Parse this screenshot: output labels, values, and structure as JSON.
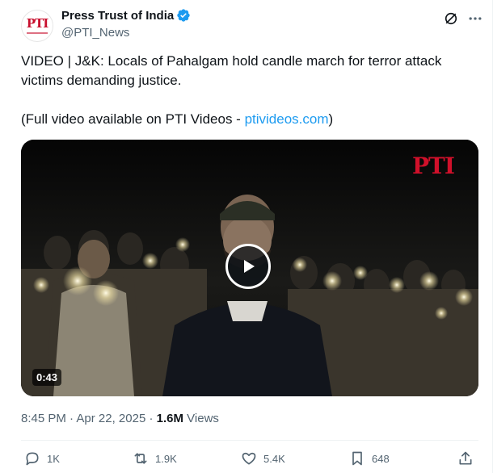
{
  "author": {
    "name": "Press Trust of India",
    "handle": "@PTI_News",
    "avatar_text": "PTI"
  },
  "post": {
    "line1": "VIDEO | J&K: Locals of Pahalgam hold candle march for terror attack victims demanding justice.",
    "line2_prefix": "(Full video available on PTI Videos - ",
    "line2_link": "ptivideos.com",
    "line2_suffix": ")"
  },
  "video": {
    "watermark": "PTI",
    "duration": "0:43"
  },
  "meta": {
    "time": "8:45 PM",
    "separator1": " · ",
    "date": "Apr 22, 2025",
    "separator2": " · ",
    "views_count": "1.6M",
    "views_label": " Views"
  },
  "actions": {
    "replies": "1K",
    "reposts": "1.9K",
    "likes": "5.4K",
    "bookmarks": "648"
  },
  "colors": {
    "accent": "#1d9bf0",
    "text": "#0f1419",
    "muted": "#536471"
  }
}
